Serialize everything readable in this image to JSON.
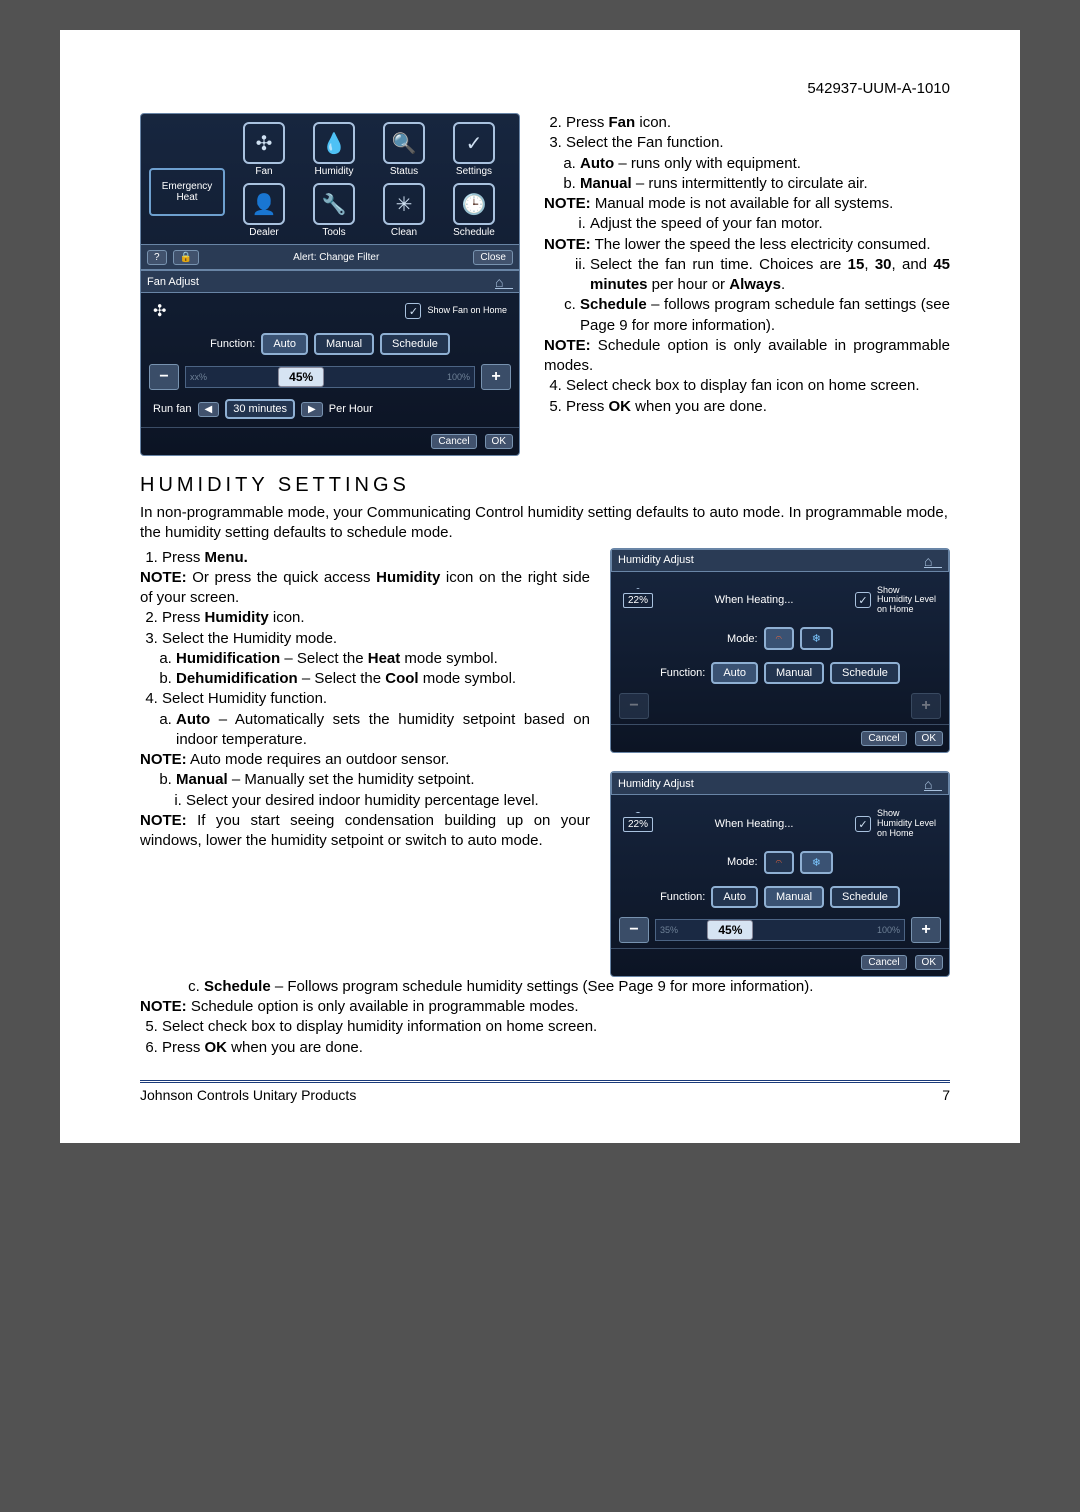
{
  "doc_id": "542937-UUM-A-1010",
  "menu_screen": {
    "emergency_heat": "Emergency Heat",
    "icons": [
      "Fan",
      "Humidity",
      "Status",
      "Settings",
      "Dealer",
      "Tools",
      "Clean",
      "Schedule"
    ],
    "alert": "Alert: Change Filter",
    "close": "Close"
  },
  "fan_adjust": {
    "title": "Fan Adjust",
    "show_label": "Show Fan on Home",
    "function_label": "Function:",
    "modes": [
      "Auto",
      "Manual",
      "Schedule"
    ],
    "slider": {
      "value": "45%",
      "min": "xx%",
      "max": "100%"
    },
    "runfan": "Run fan",
    "runvalue": "30 minutes",
    "perhour": "Per Hour",
    "cancel": "Cancel",
    "ok": "OK"
  },
  "right_steps": {
    "s2": "Press ",
    "s2b": "Fan",
    "s2e": " icon.",
    "s3": "Select the Fan function.",
    "a_b": "Auto",
    "a_t": " – runs only with equipment.",
    "b_b": "Manual",
    "b_t": " – runs intermittently to circulate air.",
    "note1": "NOTE:",
    "note1t": " Manual mode is not available for all systems.",
    "i_t": "Adjust the speed of your fan motor.",
    "note2": "NOTE:",
    "note2t": " The lower the speed the less electricity consumed.",
    "ii_a": "Select the fan run time. Choices are ",
    "ii_b1": "15",
    "ii_m": ", ",
    "ii_b2": "30",
    "ii_c": ", and ",
    "ii_b3": "45 minutes",
    "ii_d": " per hour or ",
    "ii_b4": "Always",
    "ii_e": ".",
    "c_b": "Schedule",
    "c_t": " – follows program schedule fan settings (see Page 9 for more information).",
    "note3": "NOTE:",
    "note3t": " Schedule option is only available in programmable modes.",
    "s4": "Select check box to display fan icon on home screen.",
    "s5a": "Press ",
    "s5b": "OK",
    "s5c": " when you are done."
  },
  "humidity_heading": "HUMIDITY SETTINGS",
  "humidity_intro": "In non-programmable mode, your Communicating Control humidity setting defaults to auto mode. In programmable mode, the humidity setting defaults to schedule mode.",
  "humidity_steps": {
    "s1a": "Press ",
    "s1b": "Menu.",
    "note_qa": "NOTE:",
    "note_qa_t": " Or press the quick access ",
    "note_qa_b": "Humidity",
    "note_qa_e": " icon on the right side of your screen.",
    "s2a": "Press ",
    "s2b": "Humidity",
    "s2c": " icon.",
    "s3": "Select the Humidity mode.",
    "a_b": "Humidification",
    "a_t": " – Select the ",
    "a_b2": "Heat",
    "a_e": " mode symbol.",
    "b_b": "Dehumidification",
    "b_t": " – Select the ",
    "b_b2": "Cool",
    "b_e": " mode symbol.",
    "s4": "Select Humidity function.",
    "fa_b": "Auto",
    "fa_t": " – Automatically sets the humidity setpoint based on indoor temperature.",
    "noteA": "NOTE:",
    "noteA_t": " Auto mode requires an outdoor sensor.",
    "fb_b": "Manual",
    "fb_t": " – Manually set the humidity setpoint.",
    "fi_t": "Select your desired indoor humidity percentage level.",
    "noteC": "NOTE:",
    "noteC_t": " If you start seeing condensation building up on your windows, lower the humidity setpoint or switch to auto mode.",
    "fc_b": "Schedule",
    "fc_t": " – Follows program schedule humidity settings (See Page 9 for more information).",
    "noteS": "NOTE:",
    "noteS_t": " Schedule option is only available in programmable modes.",
    "s5": "Select check box to display humidity information on home screen.",
    "s6a": "Press ",
    "s6b": "OK",
    "s6c": " when you are done."
  },
  "humidity_panel": {
    "title": "Humidity Adjust",
    "badge": "22%",
    "heating": "When Heating...",
    "show_label": "Show Humidity Level on Home",
    "mode_label": "Mode:",
    "function_label": "Function:",
    "modes": [
      "Auto",
      "Manual",
      "Schedule"
    ],
    "cancel": "Cancel",
    "ok": "OK",
    "slider": {
      "value": "45%",
      "min": "35%",
      "max": "100%"
    }
  },
  "footer_left": "Johnson Controls Unitary Products",
  "footer_right": "7"
}
